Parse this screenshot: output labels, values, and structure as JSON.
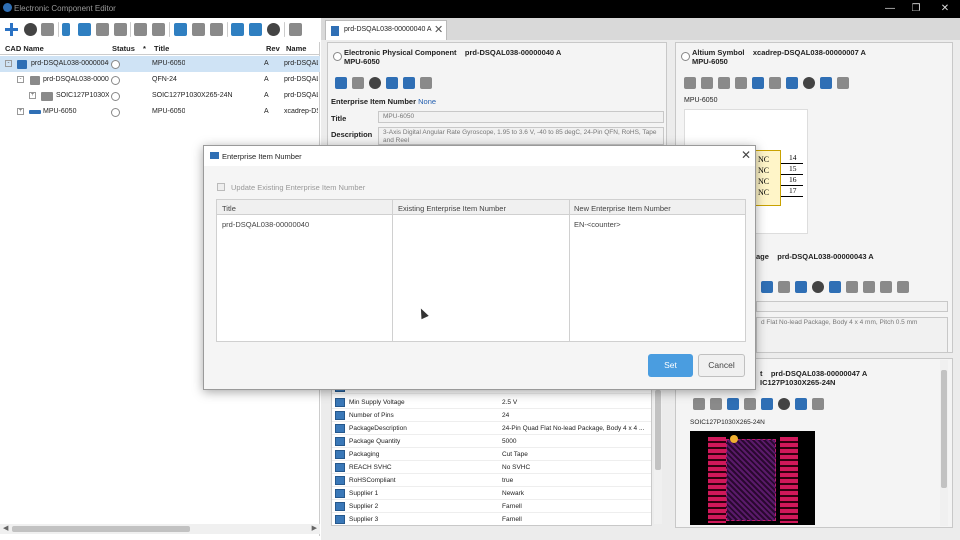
{
  "window": {
    "title": "Electronic Component Editor"
  },
  "left": {
    "columns": {
      "cad": "CAD Name",
      "status": "Status",
      "star": "*",
      "title": "Title",
      "rev": "Rev",
      "name": "Name"
    },
    "rows": [
      {
        "cad": "prd-DSQAL038-00000040",
        "title": "MPU-6050",
        "rev": "A",
        "name": "prd-DSQAL0"
      },
      {
        "cad": "prd-DSQAL038-00000",
        "title": "QFN-24",
        "rev": "A",
        "name": "prd-DSQAL0"
      },
      {
        "cad": "SOIC127P1030X2",
        "title": "SOIC127P1030X265-24N",
        "rev": "A",
        "name": "prd-DSQAL0"
      },
      {
        "cad": "MPU-6050",
        "title": "MPU-6050",
        "rev": "A",
        "name": "xcadrep-DS"
      }
    ]
  },
  "tab": {
    "label": "prd-DSQAL038-00000040 A"
  },
  "phys": {
    "title_prefix": "Electronic Physical Component",
    "id": "prd-DSQAL038-00000040 A",
    "name": "MPU-6050",
    "eil_label": "Enterprise Item Number",
    "eil_value": "None",
    "title_label": "Title",
    "title_value": "MPU-6050",
    "desc_label": "Description",
    "desc_value": "3-Axis Digital Angular Rate Gyroscope, 1.95 to 3.6 V, -40 to 85 degC, 24-Pin QFN, RoHS, Tape and Reel"
  },
  "altium": {
    "title_prefix": "Altium Symbol",
    "id": "xcadrep-DSQAL038-00000007 A",
    "name": "MPU-6050",
    "sub": "MPU-6050"
  },
  "schematic": {
    "pins": [
      {
        "label": "NC",
        "num": "14"
      },
      {
        "label": "NC",
        "num": "15"
      },
      {
        "label": "NC",
        "num": "16"
      },
      {
        "label": "NC",
        "num": "17"
      }
    ]
  },
  "pkg": {
    "title_prefix": "age",
    "id": "prd-DSQAL038-00000043 A",
    "desc": "d Flat No-lead Package, Body 4 x 4 mm, Pitch 0.5 mm"
  },
  "fp": {
    "title_prefix": "t",
    "id": "prd-DSQAL038-00000047 A",
    "name": "IC127P1030X265-24N",
    "sub": "SOIC127P1030X265-24N"
  },
  "props": [
    {
      "name": "Min Supply Voltage",
      "value": "2.5 V"
    },
    {
      "name": "Number of Pins",
      "value": "24"
    },
    {
      "name": "PackageDescription",
      "value": "24-Pin Quad Flat No-lead Package, Body 4 x 4 ..."
    },
    {
      "name": "Package Quantity",
      "value": "5000"
    },
    {
      "name": "Packaging",
      "value": "Cut Tape"
    },
    {
      "name": "REACH SVHC",
      "value": "No SVHC"
    },
    {
      "name": "RoHSCompliant",
      "value": "true"
    },
    {
      "name": "Supplier 1",
      "value": "Newark"
    },
    {
      "name": "Supplier 2",
      "value": "Farnell"
    },
    {
      "name": "Supplier 3",
      "value": "Farnell"
    }
  ],
  "modal": {
    "title": "Enterprise Item Number",
    "checkbox_label": "Update Existing Enterprise Item Number",
    "columns": {
      "title": "Title",
      "existing": "Existing Enterprise Item Number",
      "new": "New Enterprise Item Number"
    },
    "row": {
      "title": "prd-DSQAL038-00000040",
      "existing": "",
      "new": "EN-<counter>"
    },
    "set_label": "Set",
    "cancel_label": "Cancel"
  }
}
